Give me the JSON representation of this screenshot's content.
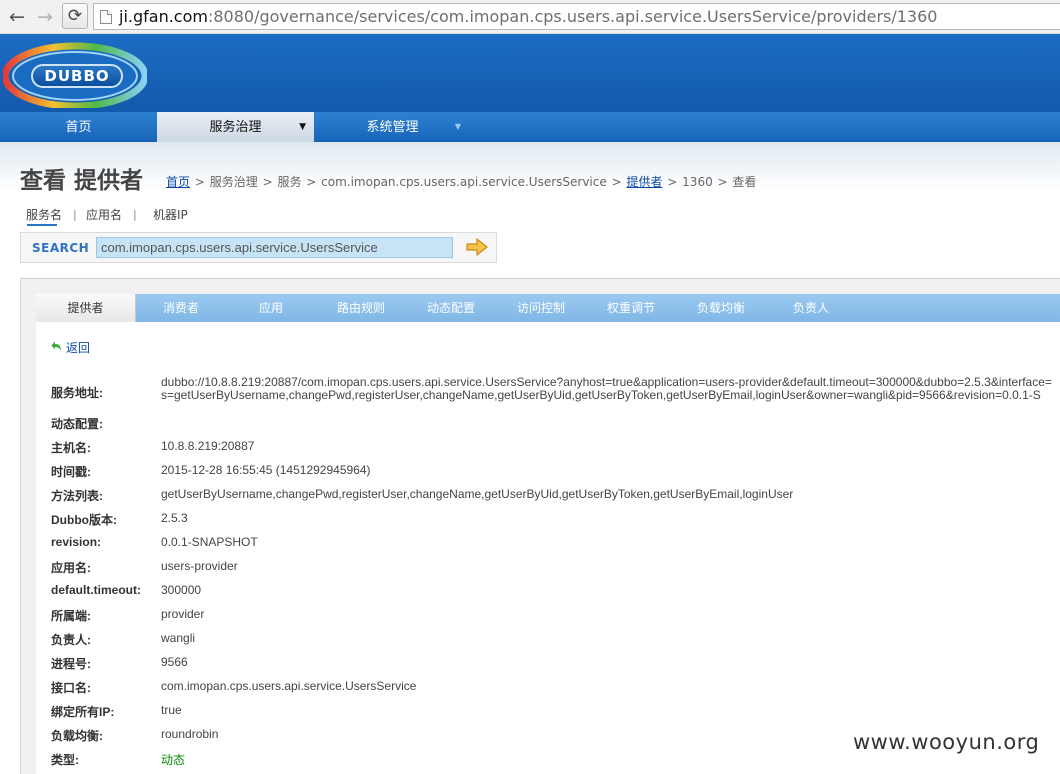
{
  "browser": {
    "url_host": "ji.gfan.com",
    "url_rest": ":8080/governance/services/com.imopan.cps.users.api.service.UsersService/providers/1360"
  },
  "header": {
    "logo_text": "DUBBO"
  },
  "menu": {
    "home": "首页",
    "governance": "服务治理",
    "system": "系统管理"
  },
  "page": {
    "title": "查看 提供者",
    "breadcrumb": {
      "home": "首页",
      "governance": "服务治理",
      "services": "服务",
      "service_name": "com.imopan.cps.users.api.service.UsersService",
      "providers": "提供者",
      "id": "1360",
      "view": "查看"
    }
  },
  "search": {
    "tabs": [
      "服务名",
      "应用名",
      "机器IP"
    ],
    "label": "SEARCH",
    "value": "com.imopan.cps.users.api.service.UsersService"
  },
  "content_tabs": [
    "提供者",
    "消费者",
    "应用",
    "路由规则",
    "动态配置",
    "访问控制",
    "权重调节",
    "负载均衡",
    "负责人"
  ],
  "back_label": "返回",
  "details": {
    "address_label": "服务地址:",
    "address_line1": "dubbo://10.8.8.219:20887/com.imopan.cps.users.api.service.UsersService?anyhost=true&application=users-provider&default.timeout=300000&dubbo=2.5.3&interface=",
    "address_line2": "s=getUserByUsername,changePwd,registerUser,changeName,getUserByUid,getUserByToken,getUserByEmail,loginUser&owner=wangli&pid=9566&revision=0.0.1-S",
    "rows": [
      {
        "label": "动态配置:",
        "value": ""
      },
      {
        "label": "主机名:",
        "value": "10.8.8.219:20887"
      },
      {
        "label": "时间戳:",
        "value": "2015-12-28 16:55:45 (1451292945964)"
      },
      {
        "label": "方法列表:",
        "value": "getUserByUsername,changePwd,registerUser,changeName,getUserByUid,getUserByToken,getUserByEmail,loginUser"
      },
      {
        "label": "Dubbo版本:",
        "value": "2.5.3"
      },
      {
        "label": "revision:",
        "value": "0.0.1-SNAPSHOT"
      },
      {
        "label": "应用名:",
        "value": "users-provider"
      },
      {
        "label": "default.timeout:",
        "value": "300000"
      },
      {
        "label": "所属端:",
        "value": "provider"
      },
      {
        "label": "负责人:",
        "value": "wangli"
      },
      {
        "label": "进程号:",
        "value": "9566"
      },
      {
        "label": "接口名:",
        "value": "com.imopan.cps.users.api.service.UsersService"
      },
      {
        "label": "绑定所有IP:",
        "value": "true"
      },
      {
        "label": "负载均衡:",
        "value": "roundrobin"
      },
      {
        "label": "类型:",
        "value": "动态"
      }
    ]
  },
  "watermark": "www.wooyun.org",
  "colors": {
    "brand_blue": "#1664b9",
    "link": "#0a48a8",
    "tab_bar": "#8fc0ea",
    "dynamic_green": "#0a8a0a"
  }
}
